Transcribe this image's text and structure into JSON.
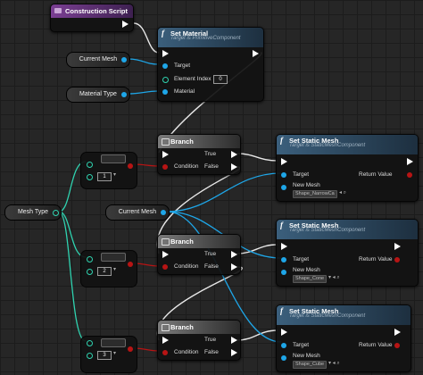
{
  "construction_script": {
    "title": "Construction Script"
  },
  "set_material": {
    "title": "Set Material",
    "subtitle": "Target is PrimitiveComponent",
    "target": "Target",
    "element_index_label": "Element Index",
    "element_index_value": "0",
    "material_label": "Material"
  },
  "vars": {
    "current_mesh": "Current Mesh",
    "material_type": "Material Type",
    "mesh_type": "Mesh Type"
  },
  "branch": {
    "title": "Branch",
    "condition": "Condition",
    "true_label": "True",
    "false_label": "False"
  },
  "equals": [
    {
      "value": "1"
    },
    {
      "value": "2"
    },
    {
      "value": "3"
    }
  ],
  "set_static_mesh": {
    "title": "Set Static Mesh",
    "subtitle": "Target is StaticMeshComponent",
    "target": "Target",
    "return_value": "Return Value",
    "new_mesh": "New Mesh",
    "assets": [
      "Shape_NarrowCa",
      "Shape_Cone",
      "Shape_Cube"
    ]
  }
}
